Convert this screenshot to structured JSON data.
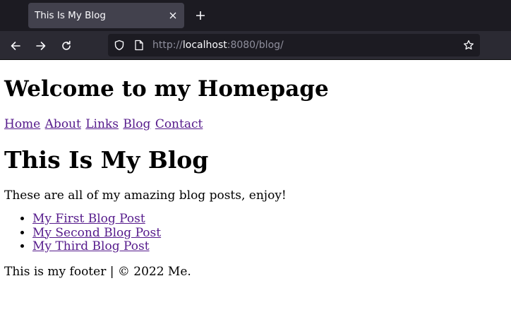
{
  "browser": {
    "tab": {
      "title": "This Is My Blog"
    },
    "url": {
      "scheme": "http://",
      "host": "localhost",
      "rest": ":8080/blog/"
    },
    "colors": {
      "tabbar_bg": "#1c1b22",
      "tab_active_bg": "#42414d",
      "navbar_bg": "#2b2a33",
      "urlbar_bg": "#1c1b22",
      "icon": "#fbfbfe"
    },
    "icons": [
      "close-icon",
      "plus-icon",
      "back-arrow-icon",
      "forward-arrow-icon",
      "reload-icon",
      "shield-icon",
      "page-icon",
      "star-icon"
    ]
  },
  "page": {
    "site_title": "Welcome to my Homepage",
    "nav": [
      {
        "label": "Home"
      },
      {
        "label": "About"
      },
      {
        "label": "Links"
      },
      {
        "label": "Blog"
      },
      {
        "label": "Contact"
      }
    ],
    "heading": "This Is My Blog",
    "intro": "These are all of my amazing blog posts, enjoy!",
    "posts": [
      {
        "title": "My First Blog Post"
      },
      {
        "title": "My Second Blog Post"
      },
      {
        "title": "My Third Blog Post"
      }
    ],
    "footer": "This is my footer | © 2022 Me.",
    "colors": {
      "link_visited": "#551a8b",
      "text": "#000000"
    }
  }
}
